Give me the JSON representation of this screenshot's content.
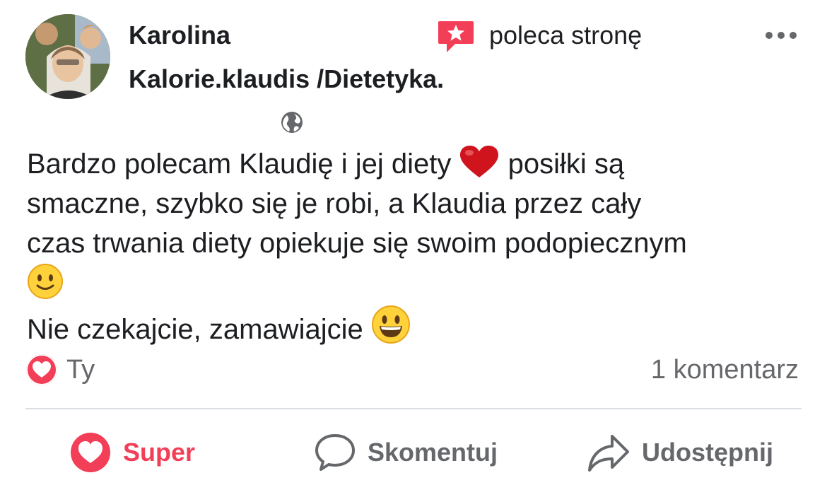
{
  "post": {
    "author": "Karolina",
    "action_text": "poleca stronę",
    "page_name": "Kalorie.klaudis /Dietetyka.",
    "body": {
      "line1_a": "Bardzo polecam Klaudię i jej diety",
      "line1_b": "posiłki są",
      "line2": "smaczne, szybko się je robi, a Klaudia przez cały",
      "line3": "czas trwania diety opiekuje się swoim podopiecznym",
      "line5": "Nie czekajcie, zamawiajcie"
    }
  },
  "reactions": {
    "reactor": "Ty",
    "comment_count": "1 komentarz"
  },
  "actions": {
    "super": "Super",
    "comment": "Skomentuj",
    "share": "Udostępnij"
  },
  "icons": {
    "recommend": "recommend-star-bubble-icon",
    "more": "more-options-icon",
    "privacy": "globe-icon",
    "heart": "red-heart-emoji",
    "smile": "slightly-smiling-emoji",
    "grin": "grinning-emoji"
  },
  "colors": {
    "accent_red": "#f33e58",
    "muted_text": "#65676b",
    "divider": "#dadde1"
  }
}
